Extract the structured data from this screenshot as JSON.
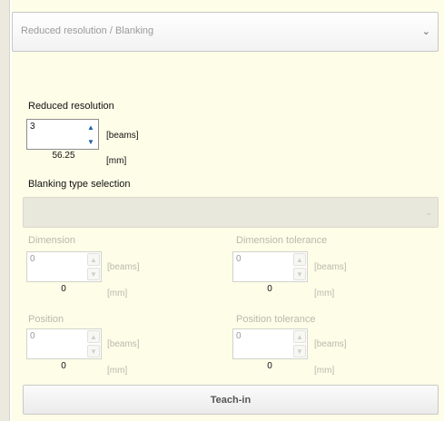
{
  "header": {
    "dropdown_value": "Reduced resolution / Blanking"
  },
  "reduced_resolution": {
    "label": "Reduced resolution",
    "value": "3",
    "unit_beams": "[beams]",
    "mm_value": "56.25",
    "unit_mm": "[mm]"
  },
  "blanking": {
    "label": "Blanking type selection",
    "selected_value": ""
  },
  "dimension": {
    "label": "Dimension",
    "value": "0",
    "unit_beams": "[beams]",
    "mm_value": "0",
    "unit_mm": "[mm]"
  },
  "dimension_tolerance": {
    "label": "Dimension tolerance",
    "value": "0",
    "unit_beams": "[beams]",
    "mm_value": "0",
    "unit_mm": "[mm]"
  },
  "position": {
    "label": "Position",
    "value": "0",
    "unit_beams": "[beams]",
    "mm_value": "0",
    "unit_mm": "[mm]"
  },
  "position_tolerance": {
    "label": "Position tolerance",
    "value": "0",
    "unit_beams": "[beams]",
    "mm_value": "0",
    "unit_mm": "[mm]"
  },
  "teach_button": {
    "label": "Teach-in"
  },
  "icons": {
    "dropdown": "chevron-down-icon",
    "spin_up": "spin-up-arrow-icon",
    "spin_down": "spin-down-arrow-icon"
  }
}
